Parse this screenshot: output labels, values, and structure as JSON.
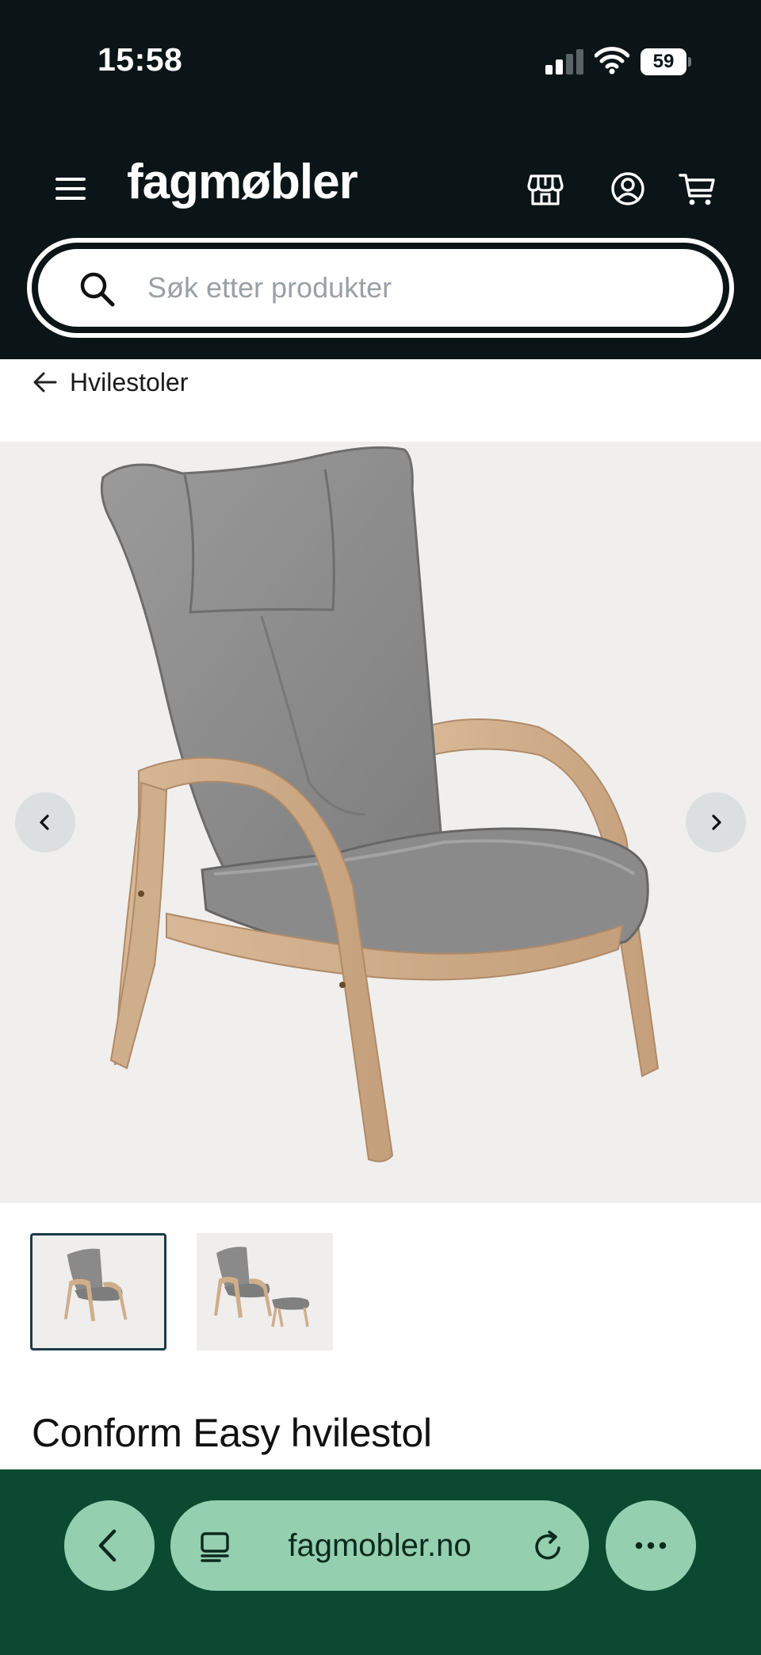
{
  "status_bar": {
    "time": "15:58",
    "battery": "59",
    "icons": [
      "cellular-signal-icon",
      "wifi-icon",
      "battery-icon"
    ]
  },
  "header": {
    "logo": "fagmøbler",
    "icons": [
      "hamburger-menu-icon",
      "store-icon",
      "account-icon",
      "cart-icon"
    ],
    "search": {
      "placeholder": "Søk etter produkter"
    }
  },
  "breadcrumb": {
    "label": "Hvilestoler"
  },
  "gallery": {
    "prev_icon": "chevron-left-icon",
    "next_icon": "chevron-right-icon",
    "thumbnails": [
      {
        "subject": "chair",
        "active": true
      },
      {
        "subject": "chair-with-footstool",
        "active": false
      }
    ]
  },
  "product": {
    "title": "Conform Easy hvilestol"
  },
  "browser": {
    "url": "fagmobler.no",
    "icons": [
      "back-icon",
      "tabs-icon",
      "reload-icon",
      "more-icon"
    ],
    "colors": {
      "bar": "#0b4a30",
      "pill": "#94cfb0"
    }
  }
}
